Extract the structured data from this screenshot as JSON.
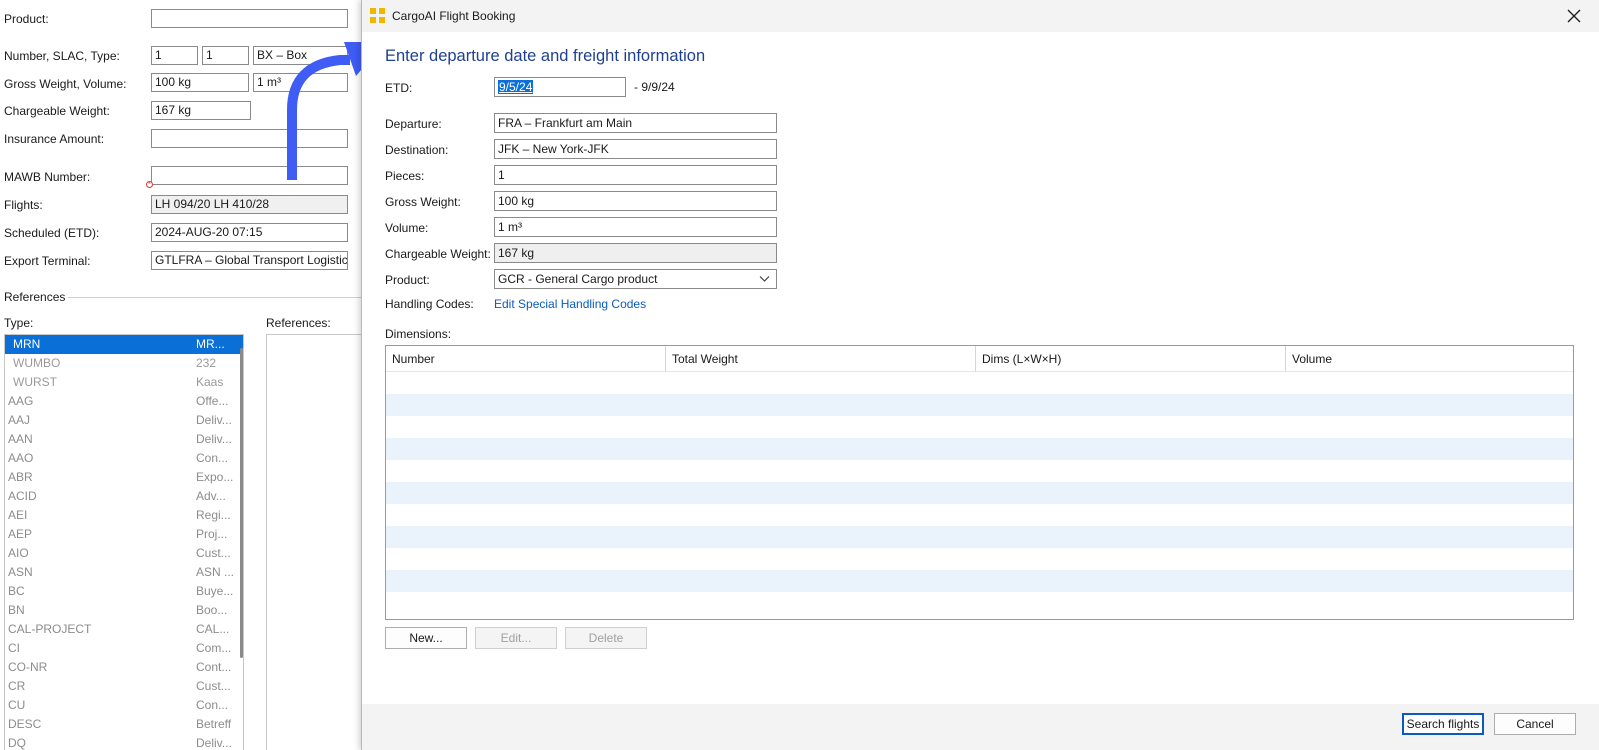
{
  "background_form": {
    "product_label": "Product:",
    "product_value": "",
    "number_label": "Number, SLAC, Type:",
    "number_value": "1",
    "slac_value": "1",
    "type_value": "BX – Box",
    "gross_label": "Gross Weight, Volume:",
    "gross_value": "100 kg",
    "volume_value": "1 m³",
    "chargeable_label": "Chargeable Weight:",
    "chargeable_value": "167 kg",
    "insurance_label": "Insurance Amount:",
    "insurance_value": "",
    "mawb_label": "MAWB Number:",
    "mawb_value": "",
    "flights_label": "Flights:",
    "flights_value": "LH 094/20 LH 410/28",
    "scheduled_label": "Scheduled (ETD):",
    "scheduled_value": "2024-AUG-20 07:15",
    "export_label": "Export Terminal:",
    "export_value": "GTLFRA – Global Transport Logistics I",
    "references_legend": "References",
    "type_label": "Type:",
    "references_label": "References:",
    "type_list": [
      {
        "code": "MRN",
        "desc": "MR...",
        "state": "selected"
      },
      {
        "code": "WUMBO",
        "desc": "232",
        "state": "grey"
      },
      {
        "code": "WURST",
        "desc": "Kaas",
        "state": "grey"
      },
      {
        "code": "AAG",
        "desc": "Offe...",
        "state": "grey2"
      },
      {
        "code": "AAJ",
        "desc": "Deliv...",
        "state": "grey2"
      },
      {
        "code": "AAN",
        "desc": "Deliv...",
        "state": "grey2"
      },
      {
        "code": "AAO",
        "desc": "Con...",
        "state": "grey2"
      },
      {
        "code": "ABR",
        "desc": "Expo...",
        "state": "grey2"
      },
      {
        "code": "ACID",
        "desc": "Adv...",
        "state": "grey2"
      },
      {
        "code": "AEI",
        "desc": "Regi...",
        "state": "grey2"
      },
      {
        "code": "AEP",
        "desc": "Proj...",
        "state": "grey2"
      },
      {
        "code": "AIO",
        "desc": "Cust...",
        "state": "grey2"
      },
      {
        "code": "ASN",
        "desc": "ASN ...",
        "state": "grey2"
      },
      {
        "code": "BC",
        "desc": "Buye...",
        "state": "grey2"
      },
      {
        "code": "BN",
        "desc": "Boo...",
        "state": "grey2"
      },
      {
        "code": "CAL-PROJECT",
        "desc": "CAL...",
        "state": "grey2"
      },
      {
        "code": "CI",
        "desc": "Com...",
        "state": "grey2"
      },
      {
        "code": "CO-NR",
        "desc": "Cont...",
        "state": "grey2"
      },
      {
        "code": "CR",
        "desc": "Cust...",
        "state": "grey2"
      },
      {
        "code": "CU",
        "desc": "Con...",
        "state": "grey2"
      },
      {
        "code": "DESC",
        "desc": "Betreff",
        "state": "grey2"
      },
      {
        "code": "DQ",
        "desc": "Deliv...",
        "state": "grey2"
      }
    ]
  },
  "dialog": {
    "title": "CargoAI Flight Booking",
    "close_icon": "close-icon",
    "heading": "Enter departure date and freight information",
    "etd_label": "ETD:",
    "etd_value": "9/5/24",
    "etd_to": "-  9/9/24",
    "departure_label": "Departure:",
    "departure_value": "FRA – Frankfurt am Main",
    "destination_label": "Destination:",
    "destination_value": "JFK – New York-JFK",
    "pieces_label": "Pieces:",
    "pieces_value": "1",
    "gross_label": "Gross Weight:",
    "gross_value": "100 kg",
    "volume_label": "Volume:",
    "volume_value": "1 m³",
    "chargeable_label": "Chargeable Weight:",
    "chargeable_value": "167 kg",
    "product_label": "Product:",
    "product_value": "GCR - General Cargo product",
    "handling_label": "Handling Codes:",
    "handling_link": "Edit Special Handling Codes",
    "dimensions_label": "Dimensions:",
    "table_headers": [
      "Number",
      "Total Weight",
      "Dims (L×W×H)",
      "Volume"
    ],
    "buttons": {
      "new": "New...",
      "edit": "Edit...",
      "delete": "Delete",
      "search": "Search flights",
      "cancel": "Cancel"
    }
  },
  "colors": {
    "accent": "#0a6fd6",
    "heading": "#1f3f91",
    "link": "#0a5ac2",
    "arrow": "#3f5cf5",
    "app_icon": "#f2b600"
  }
}
